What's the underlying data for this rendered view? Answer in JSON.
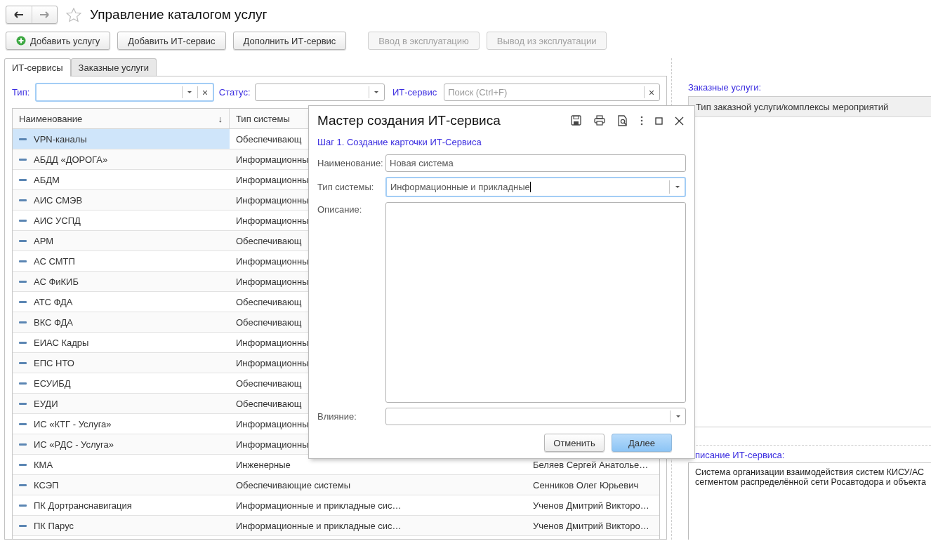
{
  "window": {
    "title": "Управление каталогом услуг"
  },
  "toolbar": [
    {
      "label": "Добавить услугу",
      "kind": "add",
      "disabled": false
    },
    {
      "label": "Добавить ИТ-сервис",
      "disabled": false
    },
    {
      "label": "Дополнить ИТ-сервис",
      "disabled": false
    },
    {
      "label": "Ввод в эксплуатацию",
      "disabled": true
    },
    {
      "label": "Вывод из эксплуатации",
      "disabled": true
    }
  ],
  "tabs": [
    {
      "label": "ИТ-сервисы",
      "selected": true
    },
    {
      "label": "Заказные услуги",
      "selected": false
    }
  ],
  "filters": {
    "type_label": "Тип:",
    "type_focused": true,
    "status_label": "Статус:",
    "service_label": "ИТ-сервис",
    "search": {
      "placeholder": "Поиск (Ctrl+F)"
    }
  },
  "table": {
    "columns": [
      {
        "label": "Наименование",
        "sort_mark": "↓"
      },
      {
        "label": "Тип системы"
      }
    ],
    "rows": [
      {
        "name": "VPN-каналы",
        "type": "Обеспечивающ",
        "selected": true
      },
      {
        "name": "АБДД «ДОРОГА»",
        "type": "Информационны",
        "selected": false
      },
      {
        "name": "АБДМ",
        "type": "Информационны",
        "selected": false
      },
      {
        "name": "АИС СМЭВ",
        "type": "Информационны",
        "selected": false
      },
      {
        "name": "АИС УСПД",
        "type": "Информационны",
        "selected": false
      },
      {
        "name": "АРМ",
        "type": "Обеспечивающ",
        "selected": false
      },
      {
        "name": "АС СМТП",
        "type": "Информационны",
        "selected": false
      },
      {
        "name": "АС ФиКИБ",
        "type": "Информационны",
        "selected": false
      },
      {
        "name": "АТС ФДА",
        "type": "Обеспечивающ",
        "selected": false
      },
      {
        "name": "ВКС ФДА",
        "type": "Обеспечивающ",
        "selected": false
      },
      {
        "name": "ЕИАС Кадры",
        "type": "Информационны",
        "selected": false
      },
      {
        "name": "ЕПС НТО",
        "type": "Информационны",
        "selected": false
      },
      {
        "name": "ЕСУИБД",
        "type": "Обеспечивающ",
        "selected": false
      },
      {
        "name": "ЕУДИ",
        "type": "Обеспечивающ",
        "selected": false
      },
      {
        "name": "ИС «КТГ - Услуга»",
        "type": "Информационны",
        "selected": false
      },
      {
        "name": "ИС «РДС - Услуга»",
        "type": "Информационны",
        "selected": false
      },
      {
        "name": "КМА",
        "type": "Инженерные",
        "column_4": "Беляев Сергей Анатолье…",
        "selected": false
      },
      {
        "name": "КСЭП",
        "type": "Обеспечивающие системы",
        "column_4": "Сенников Олег Юрьевич",
        "selected": false
      },
      {
        "name": "ПК Дортранснавигация",
        "type": "Информационные и прикладные сис…",
        "column_4": "Ученов Дмитрий Викторо…",
        "selected": false
      },
      {
        "name": "ПК Парус",
        "type": "Информационные и прикладные сис…",
        "column_4": "Ученов Дмитрий Викторо…",
        "selected": false
      }
    ]
  },
  "custom_services": {
    "label": "Заказные услуги:",
    "columns": [
      "Тип заказной услуги/комплексы мероприятий"
    ]
  },
  "description": {
    "label": "писание ИТ-сервиса:",
    "lines": [
      "Система организации взаимодействия систем КИСУ/АС",
      "сегментом распределённой сети Росавтодора и объекта"
    ]
  },
  "dialog": {
    "title": "Мастер создания ИТ-сервиса",
    "step": "Шаг 1. Создание карточки ИТ-Сервиса",
    "fields": [
      {
        "label": "Наименование:",
        "kind": "text",
        "value": "Новая система",
        "focused": false
      },
      {
        "label": "Тип системы:",
        "kind": "select",
        "value": "Информационные и прикладные",
        "focused": true
      },
      {
        "label": "Описание:",
        "kind": "textarea",
        "focused": false
      },
      {
        "label": "Влияние:",
        "kind": "select",
        "focused": false
      }
    ],
    "buttons": [
      {
        "label": "Отменить",
        "default": false
      },
      {
        "label": "Далее",
        "default": true
      }
    ]
  }
}
